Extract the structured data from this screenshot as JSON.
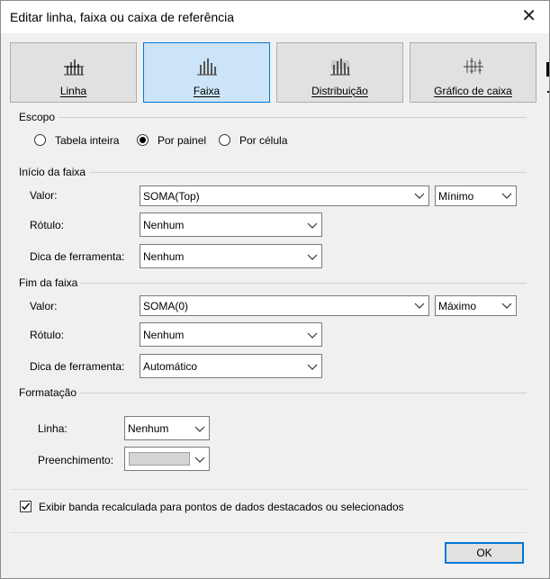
{
  "window": {
    "title": "Editar linha, faixa ou caixa de referência",
    "close": "✕"
  },
  "tabs": [
    {
      "label": "Linha",
      "icon": "bar-chart-line-icon",
      "active": false
    },
    {
      "label": "Faixa",
      "icon": "bar-chart-band-icon",
      "active": true
    },
    {
      "label": "Distribuição",
      "icon": "bar-chart-distribution-icon",
      "active": false
    },
    {
      "label": "Gráfico de caixa",
      "icon": "box-plot-icon",
      "active": false
    }
  ],
  "scope": {
    "title": "Escopo",
    "options": [
      {
        "label": "Tabela inteira",
        "selected": false
      },
      {
        "label": "Por painel",
        "selected": true
      },
      {
        "label": "Por célula",
        "selected": false
      }
    ]
  },
  "band_start": {
    "title": "Início da faixa",
    "value_label": "Valor:",
    "value": "SOMA(Top)",
    "aggregation": "Mínimo",
    "label_label": "Rótulo:",
    "label_value": "Nenhum",
    "tooltip_label": "Dica de ferramenta:",
    "tooltip_value": "Nenhum"
  },
  "band_end": {
    "title": "Fim da faixa",
    "value_label": "Valor:",
    "value": "SOMA(0)",
    "aggregation": "Máximo",
    "label_label": "Rótulo:",
    "label_value": "Nenhum",
    "tooltip_label": "Dica de ferramenta:",
    "tooltip_value": "Automático"
  },
  "formatting": {
    "title": "Formatação",
    "line_label": "Linha:",
    "line_value": "Nenhum",
    "fill_label": "Preenchimento:",
    "fill_color": "#d4d4d4"
  },
  "recalc": {
    "label": "Exibir banda recalculada para pontos de dados destacados ou selecionados",
    "checked": true
  },
  "ok_label": "OK",
  "colors": {
    "accent": "#0078d7",
    "active_tab": "#cce4f7"
  }
}
